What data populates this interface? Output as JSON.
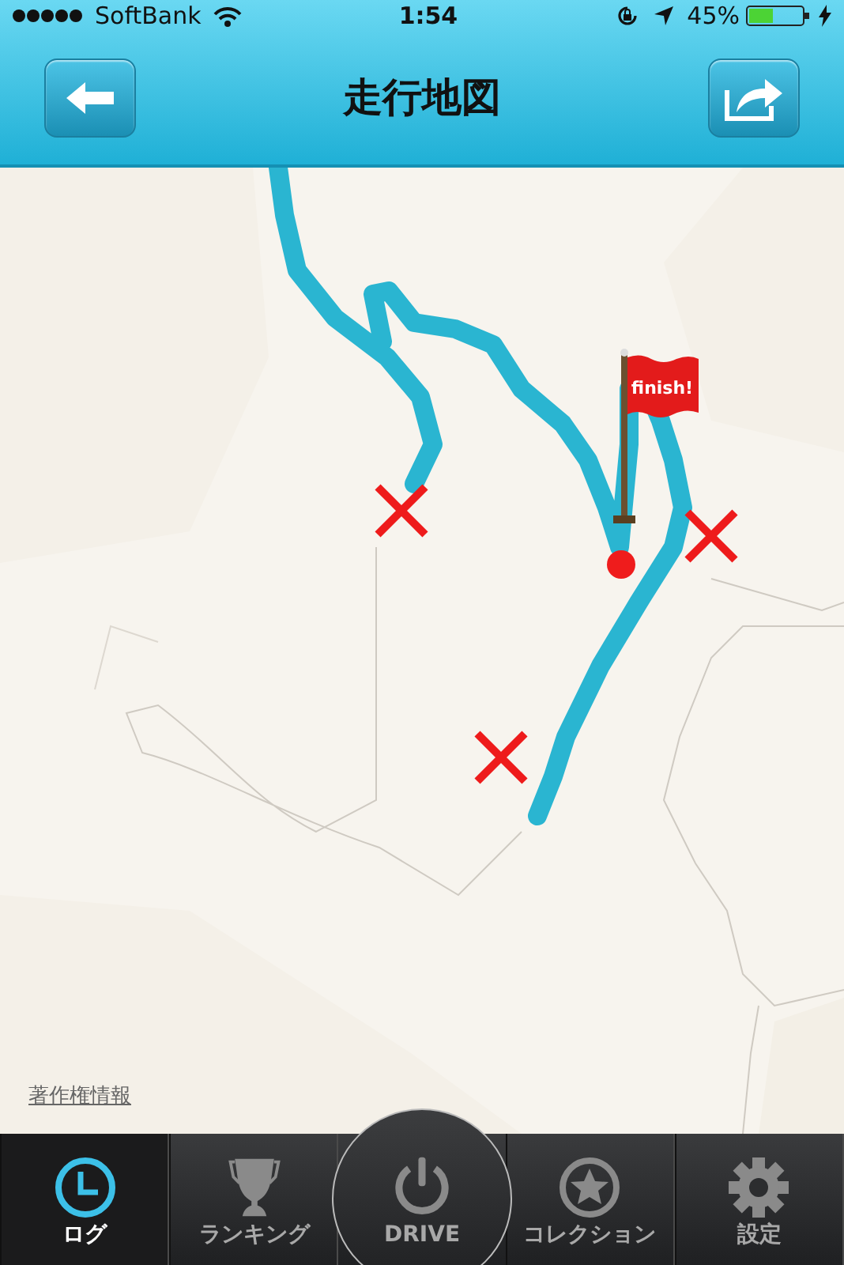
{
  "status_bar": {
    "carrier": "SoftBank",
    "time": "1:54",
    "battery_percent": "45%"
  },
  "header": {
    "title": "走行地図"
  },
  "map": {
    "kind": "picture",
    "flag_label": "finish!",
    "copyright_link": "著作権情報"
  },
  "tabs": [
    {
      "kind": "log",
      "label": "ログ",
      "selected": true
    },
    {
      "kind": "ranking",
      "label": "ランキング",
      "selected": false
    },
    {
      "kind": "drive",
      "label": "DRIVE",
      "selected": false
    },
    {
      "kind": "collection",
      "label": "コレクション",
      "selected": false
    },
    {
      "kind": "settings",
      "label": "設定",
      "selected": false
    }
  ]
}
